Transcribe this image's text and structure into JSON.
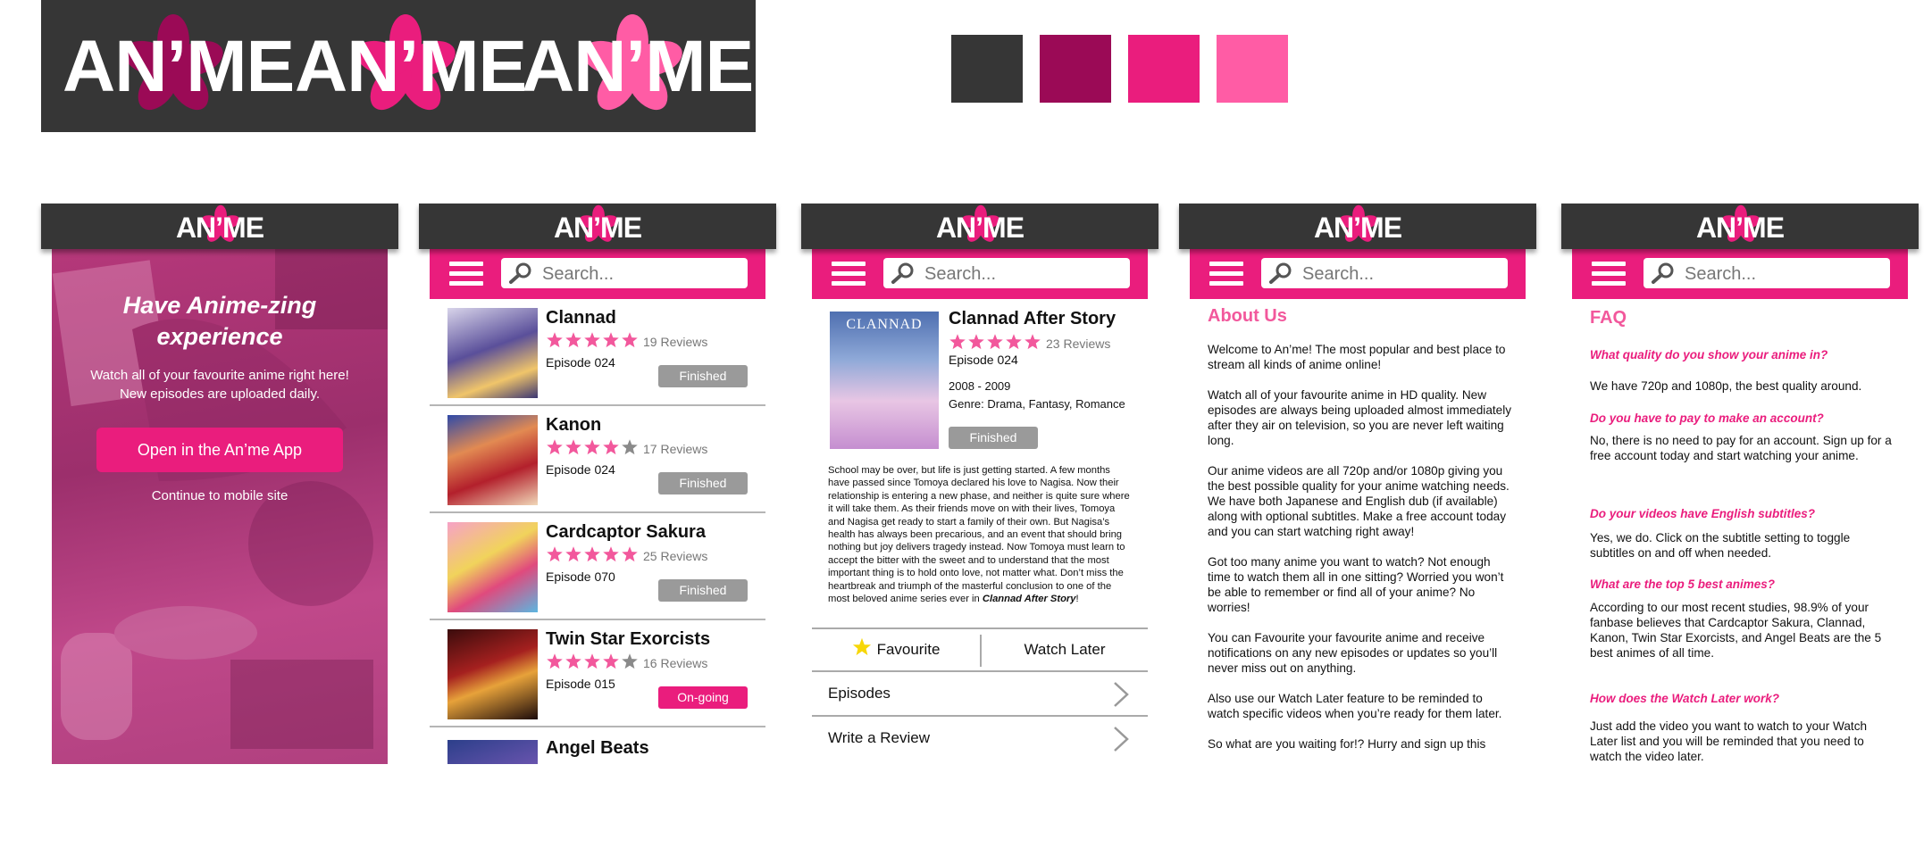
{
  "brand": {
    "logo_text": "AN’ME",
    "colors": [
      "#363636",
      "#9b0a56",
      "#ea1d7d",
      "#ff5ca5"
    ]
  },
  "phones": {
    "landing": {
      "header_logo": "AN’ME",
      "title_line1": "Have Anime-zing",
      "title_line2": "experience",
      "subtitle_line1": "Watch all of your favourite anime right here!",
      "subtitle_line2": "New episodes are uploaded daily.",
      "open_app_label": "Open in  the An’me App",
      "continue_label": "Continue to mobile site"
    },
    "list": {
      "header_logo": "AN’ME",
      "search_placeholder": "Search...",
      "items": [
        {
          "title": "Clannad",
          "rating": 5,
          "reviews": "19 Reviews",
          "episode": "Episode 024",
          "status": "Finished"
        },
        {
          "title": "Kanon",
          "rating": 4,
          "reviews": "17 Reviews",
          "episode": "Episode 024",
          "status": "Finished"
        },
        {
          "title": "Cardcaptor Sakura",
          "rating": 5,
          "reviews": "25 Reviews",
          "episode": "Episode 070",
          "status": "Finished"
        },
        {
          "title": "Twin Star Exorcists",
          "rating": 4,
          "reviews": "16 Reviews",
          "episode": "Episode 015",
          "status": "On-going"
        },
        {
          "title": "Angel Beats"
        }
      ]
    },
    "detail": {
      "header_logo": "AN’ME",
      "search_placeholder": "Search...",
      "cover_text": "CLANNAD",
      "title": "Clannad After Story",
      "rating": 5,
      "reviews": "23 Reviews",
      "episode": "Episode 024",
      "years": "2008 - 2009",
      "genre": "Genre: Drama, Fantasy, Romance",
      "status": "Finished",
      "synopsis": "School may be over, but life is just getting started. A few months have passed since Tomoya declared his love to Nagisa. Now their relationship is entering a new phase, and neither is quite sure where it will take them. As their friends move on with their lives, Tomoya and Nagisa get ready to start a family of their own. But Nagisa’s health has always been precarious, and an event that should bring nothing but joy delivers tragedy instead. Now Tomoya must learn to accept the bitter with the sweet and to understand that the most important thing is to hold onto love, not matter what. Don’t miss the heartbreak and triumph of the masterful conclusion to one of the most beloved anime series ever in ",
      "synopsis_em": "Clannad After Story",
      "synopsis_end": "!",
      "favourite_label": "Favourite",
      "watch_later_label": "Watch Later",
      "episodes_label": "Episodes",
      "review_label": "Write a Review"
    },
    "about": {
      "header_logo": "AN’ME",
      "search_placeholder": "Search...",
      "heading": "About Us",
      "paragraphs": [
        "Welcome to An’me! The most popular and best place to stream all kinds of anime online!",
        "Watch all of your favourite anime in HD quality. New episodes are always being uploaded almost immediately after they air on television, so you are never left waiting long.",
        "Our anime videos are all 720p and/or 1080p giving you the best possible quality for your anime watching needs. We have both Japanese and English dub (if available) along with optional subtitles. Make a free account today and you can start watching right away!",
        "Got too many anime you want to watch? Not enough time to watch them all in one sitting? Worried you won’t be able to remember or find all of your anime? No worries!",
        "You can Favourite your favourite anime and receive notifications on any new episodes or updates so you’ll never miss out on anything.",
        "Also use our Watch Later feature to be reminded to watch specific videos when you’re ready for them later.",
        "So what are you waiting for!? Hurry and sign up this"
      ]
    },
    "faq": {
      "header_logo": "AN’ME",
      "search_placeholder": "Search...",
      "heading": "FAQ",
      "entries": [
        {
          "q": "What quality do you show your anime in?",
          "a": "We have 720p and 1080p, the best quality around."
        },
        {
          "q": "Do you have to pay to make an account?",
          "a": "No, there is no need to pay for an account. Sign up for a free account today and start watching your anime."
        },
        {
          "q": "Do your videos have English subtitles?",
          "a": "Yes, we do. Click on the subtitle setting to toggle subtitles on and off when needed."
        },
        {
          "q": "What are the top 5 best animes?",
          "a": "According to our most recent studies, 98.9% of your fanbase believes that Cardcaptor Sakura, Clannad, Kanon, Twin Star Exorcists, and Angel Beats are the 5 best animes of all time."
        },
        {
          "q": "How does the Watch Later work?",
          "a": "Just add the video you want to watch to your Watch Later list and you will be reminded that you need to watch the video later."
        }
      ]
    }
  }
}
